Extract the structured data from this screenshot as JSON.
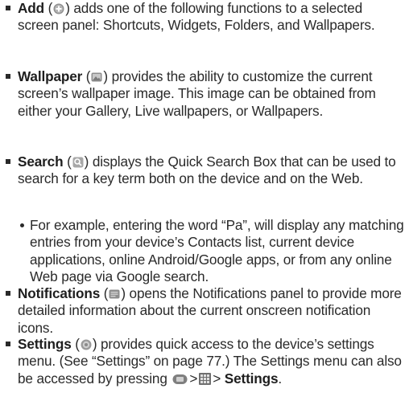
{
  "items": [
    {
      "title": "Add",
      "icon": "add-circle-icon",
      "text_before": "(",
      "text_after": ") adds one of the following functions to a selected screen panel: Shortcuts, Widgets, Folders, and Wallpapers."
    },
    {
      "title": "Wallpaper",
      "icon": "wallpaper-icon",
      "text_before": "(",
      "text_after": ") provides the ability to customize the current screen’s wallpaper image. This image can be obtained from either your Gallery, Live wallpapers, or Wallpapers."
    },
    {
      "title": "Search",
      "icon": "search-icon",
      "text_before": "(",
      "text_after": ") displays the Quick Search Box that can be used to search for a key term both on the device and on the Web."
    },
    {
      "sub": true,
      "text": "For example, entering the word “Pa”, will display any matching entries from your device’s Contacts list, current device applications, online Android/Google apps, or from any online Web page via Google search."
    },
    {
      "title": "Notifications",
      "icon": "notifications-icon",
      "text_before": "(",
      "text_after": ") opens the Notifications panel to provide more detailed information about the current onscreen notification icons."
    },
    {
      "title": "Settings",
      "icon": "settings-icon",
      "text_before": "(",
      "text_after_1": ") provides quick access to the device’s settings menu. (See “Settings” on page 77.) The Settings menu can also be accessed by pressing",
      "sep1": ">",
      "sep2": ">",
      "final_bold": "Settings",
      "final_punct": ".",
      "menu_key_icon": "menu-key-icon",
      "apps_icon": "apps-grid-icon"
    }
  ],
  "colors": {
    "text": "#2a2a2a",
    "icon_fill": "#9a9a9a",
    "icon_dark": "#666666"
  }
}
